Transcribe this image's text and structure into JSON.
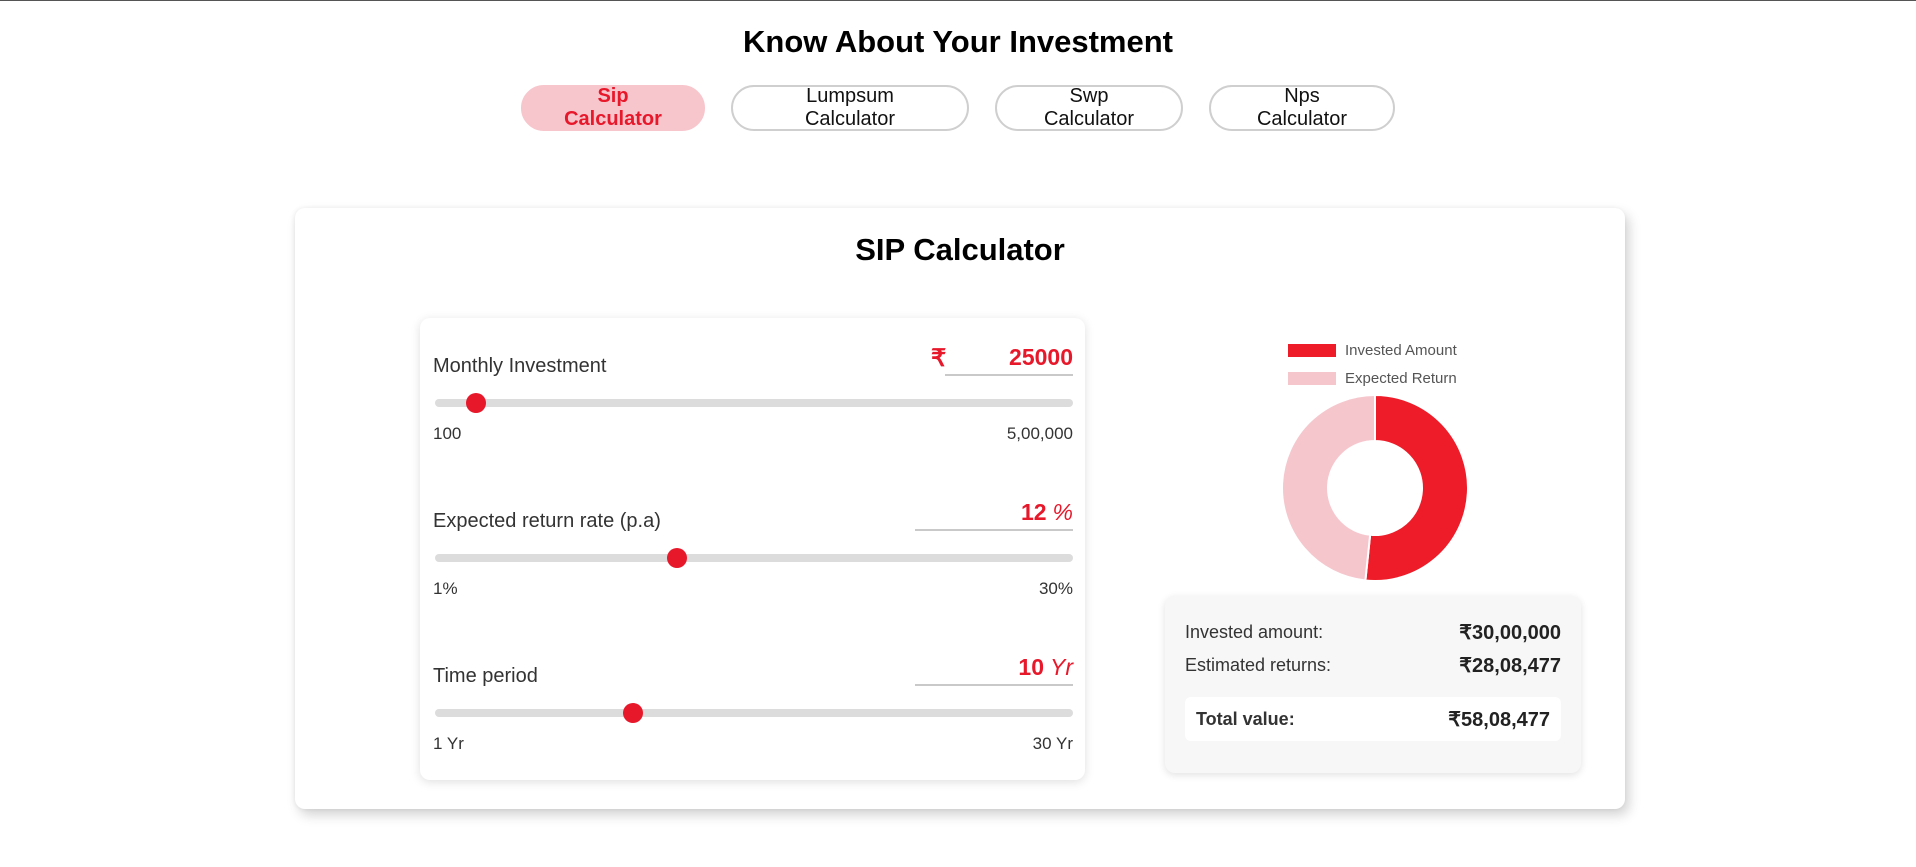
{
  "page_title": "Know About Your Investment",
  "tabs": [
    {
      "label": "Sip Calculator",
      "active": true
    },
    {
      "label": "Lumpsum Calculator",
      "active": false
    },
    {
      "label": "Swp Calculator",
      "active": false
    },
    {
      "label": "Nps Calculator",
      "active": false
    }
  ],
  "calculator": {
    "title": "SIP Calculator",
    "monthly_investment": {
      "label": "Monthly Investment",
      "currency": "₹",
      "value": "25000",
      "min_label": "100",
      "max_label": "5,00,000",
      "min": 100,
      "max": 500000,
      "current": 25000
    },
    "return_rate": {
      "label": "Expected return rate (p.a)",
      "value": "12",
      "suffix": "%",
      "min_label": "1%",
      "max_label": "30%",
      "min": 1,
      "max": 30,
      "current": 12
    },
    "time_period": {
      "label": "Time period",
      "value": "10",
      "suffix": "Yr",
      "min_label": "1 Yr",
      "max_label": "30 Yr",
      "min": 1,
      "max": 30,
      "current": 10
    }
  },
  "legend": {
    "invested_label": "Invested Amount",
    "returns_label": "Expected Return"
  },
  "colors": {
    "accent": "#e8182b",
    "invested": "#ee1b28",
    "returns": "#f6c6cd"
  },
  "chart_data": {
    "type": "pie",
    "labels": [
      "Invested Amount",
      "Expected Return"
    ],
    "values": [
      3000000,
      2808477
    ]
  },
  "summary": {
    "invested_label": "Invested amount:",
    "invested_value": "₹30,00,000",
    "returns_label": "Estimated returns:",
    "returns_value": "₹28,08,477",
    "total_label": "Total value:",
    "total_value": "₹58,08,477"
  }
}
